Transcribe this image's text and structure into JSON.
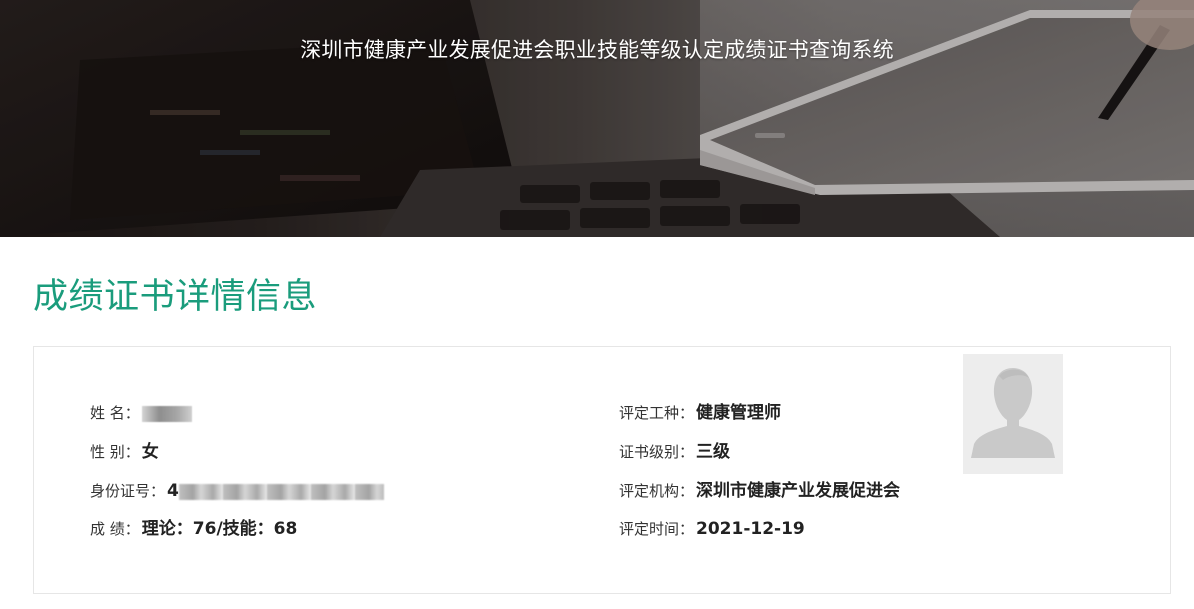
{
  "header": {
    "title": "深圳市健康产业发展促进会职业技能等级认定成绩证书查询系统"
  },
  "section": {
    "title": "成绩证书详情信息"
  },
  "details": {
    "name": {
      "label": "姓 名：",
      "value": ""
    },
    "gender": {
      "label": "性 别：",
      "value": "女"
    },
    "id_number": {
      "label": "身份证号：",
      "value": "4"
    },
    "score": {
      "label": "成 绩：",
      "value": "理论：76/技能：68"
    },
    "occupation": {
      "label": "评定工种：",
      "value": "健康管理师"
    },
    "level": {
      "label": "证书级别：",
      "value": "三级"
    },
    "organization": {
      "label": "评定机构：",
      "value": "深圳市健康产业发展促进会"
    },
    "date": {
      "label": "评定时间：",
      "value": "2021-12-19"
    }
  },
  "avatar": {
    "icon": "person-silhouette-icon"
  },
  "colors": {
    "accent": "#1a9c7c",
    "card_border": "#e6e6e6",
    "avatar_bg": "#ededed"
  }
}
